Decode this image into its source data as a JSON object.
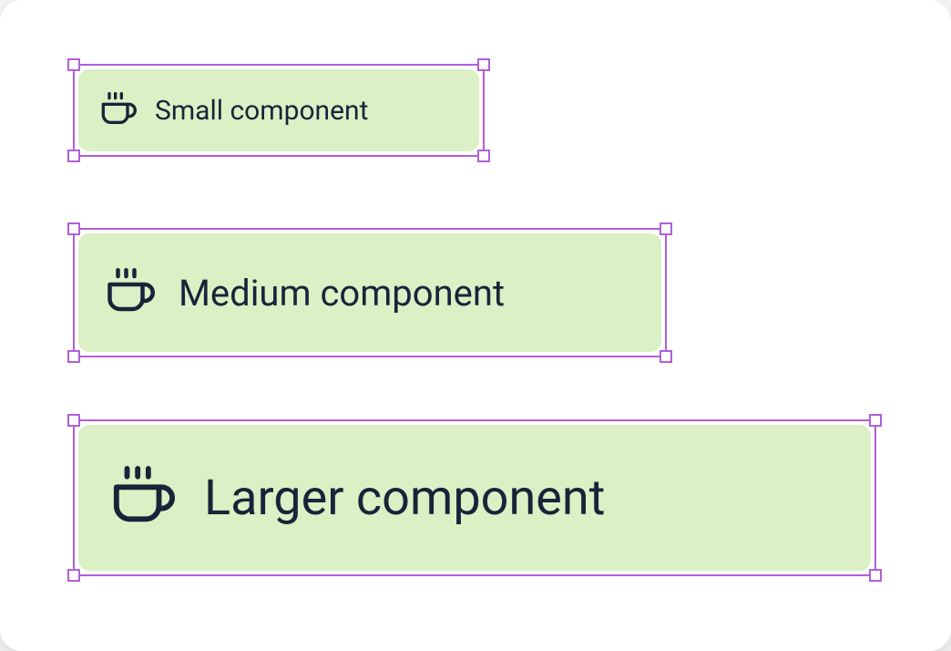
{
  "components": {
    "small": {
      "label": "Small component",
      "icon": "coffee"
    },
    "medium": {
      "label": "Medium component",
      "icon": "coffee"
    },
    "large": {
      "label": "Larger component",
      "icon": "coffee"
    }
  },
  "colors": {
    "selection": "#b15fd8",
    "componentBg": "#dcf0c5",
    "text": "#18243a",
    "canvas": "#ffffff"
  }
}
